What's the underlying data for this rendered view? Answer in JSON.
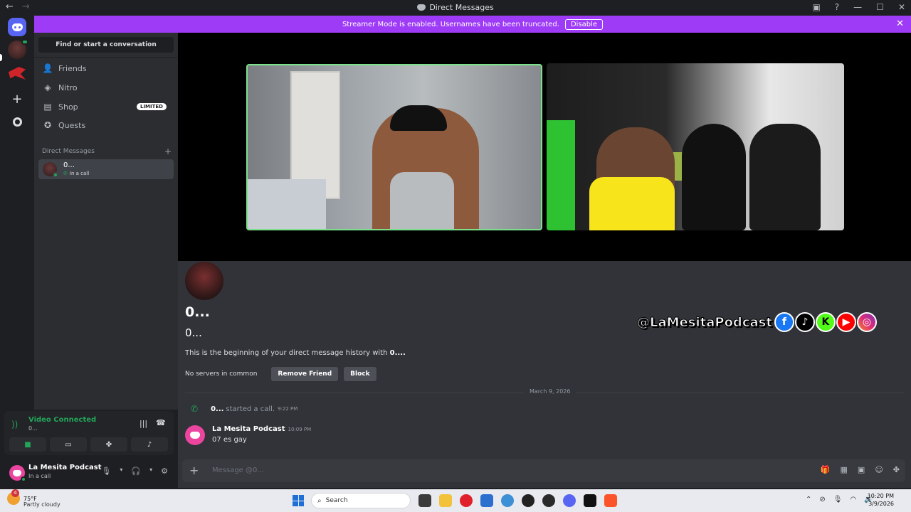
{
  "window": {
    "title": "Direct Messages",
    "back": "←",
    "forward": "→"
  },
  "banner": {
    "text": "Streamer Mode is enabled. Usernames have been truncated.",
    "disable_label": "Disable"
  },
  "sidebar": {
    "search_label": "Find or start a conversation",
    "nav": [
      {
        "label": "Friends",
        "icon": "friends-icon"
      },
      {
        "label": "Nitro",
        "icon": "nitro-icon"
      },
      {
        "label": "Shop",
        "icon": "shop-icon",
        "badge": "LIMITED"
      },
      {
        "label": "Quests",
        "icon": "quests-icon"
      }
    ],
    "dm_header": "Direct Messages",
    "dm": {
      "name": "0...",
      "status": "In a call"
    }
  },
  "voice": {
    "status": "Video Connected",
    "channel": "0..."
  },
  "user": {
    "name": "La Mesita Podcast",
    "status": "In a call"
  },
  "profile": {
    "display_name": "0...",
    "username": "0...",
    "history_prefix": "This is the beginning of your direct message history with ",
    "history_name": "0....",
    "servers": "No servers in common",
    "remove_label": "Remove Friend",
    "block_label": "Block"
  },
  "overlay": {
    "handle": "@LaMesitaPodcast"
  },
  "messages": {
    "date": "March 9, 2026",
    "call": {
      "author": "0...",
      "text": "started a call.",
      "time": "9:22 PM"
    },
    "msg": {
      "author": "La Mesita Podcast",
      "time": "10:09 PM",
      "text": "07 es gay"
    }
  },
  "composer": {
    "placeholder": "Message @0..."
  },
  "taskbar": {
    "temp": "75°F",
    "weather": "Partly cloudy",
    "weather_badge": "4",
    "search": "Search",
    "time": "10:20 PM",
    "date": "3/9/2026"
  },
  "colors": {
    "accent": "#5865f2",
    "banner": "#9e3bf7",
    "online": "#23a559"
  }
}
